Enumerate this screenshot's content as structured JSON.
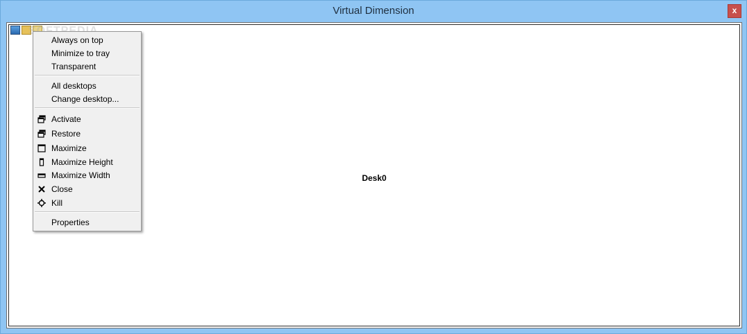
{
  "window": {
    "title": "Virtual Dimension",
    "close_glyph": "x",
    "desk_label": "Desk0",
    "watermark": "SOFTPEDIA"
  },
  "context_menu": {
    "group1": [
      "Always on top",
      "Minimize to tray",
      "Transparent"
    ],
    "group2": [
      "All desktops",
      "Change desktop..."
    ],
    "group3": [
      {
        "label": "Activate",
        "icon": "restore-window-icon"
      },
      {
        "label": "Restore",
        "icon": "restore-window-icon"
      },
      {
        "label": "Maximize",
        "icon": "maximize-icon"
      },
      {
        "label": "Maximize Height",
        "icon": "maximize-height-icon"
      },
      {
        "label": "Maximize Width",
        "icon": "maximize-width-icon"
      },
      {
        "label": "Close",
        "icon": "close-icon"
      },
      {
        "label": "Kill",
        "icon": "crosshair-icon"
      }
    ],
    "group4": [
      "Properties"
    ]
  },
  "colors": {
    "frame": "#8fc5f3",
    "close_button": "#c7504c",
    "menu_bg": "#f0f0f0"
  }
}
